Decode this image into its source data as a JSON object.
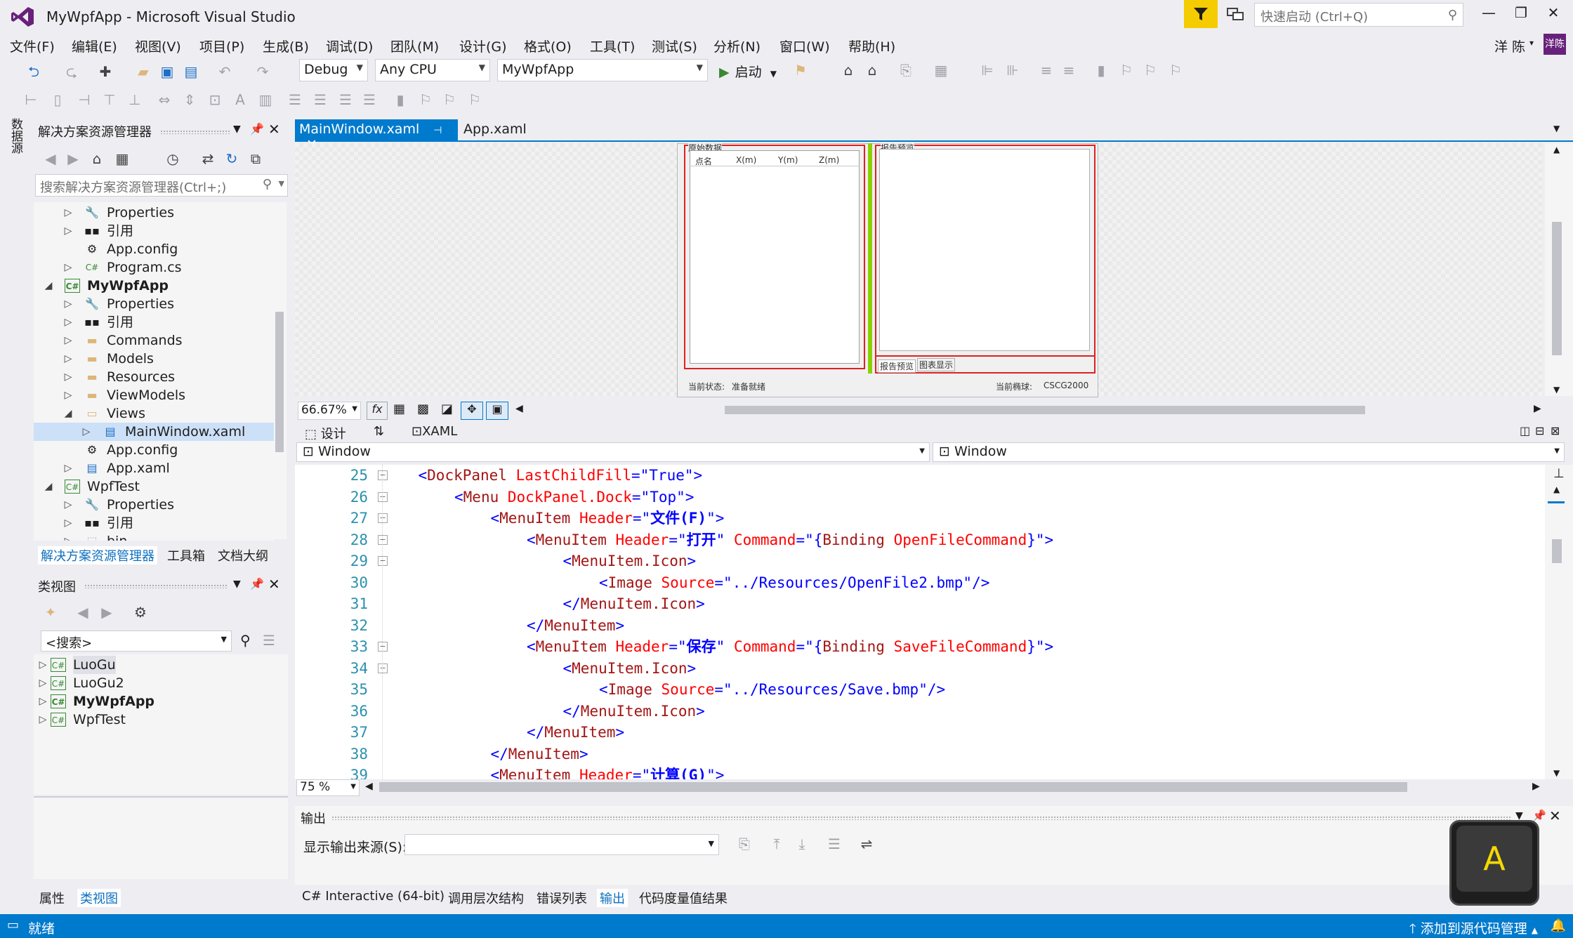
{
  "window": {
    "title": "MyWpfApp - Microsoft Visual Studio",
    "quick_launch_placeholder": "快速启动 (Ctrl+Q)",
    "user": "洋 陈",
    "avatar": "洋陈"
  },
  "menu": [
    "文件(F)",
    "编辑(E)",
    "视图(V)",
    "项目(P)",
    "生成(B)",
    "调试(D)",
    "团队(M)",
    "设计(G)",
    "格式(O)",
    "工具(T)",
    "测试(S)",
    "分析(N)",
    "窗口(W)",
    "帮助(H)"
  ],
  "toolbar": {
    "config": "Debug",
    "platform": "Any CPU",
    "startup_project": "MyWpfApp",
    "start_label": "启动"
  },
  "side_strip": {
    "datasource_label": "数据源"
  },
  "solution_explorer": {
    "title": "解决方案资源管理器",
    "search_placeholder": "搜索解决方案资源管理器(Ctrl+;)",
    "items": [
      {
        "label": "Properties",
        "icon": "wrench-icon",
        "bold": false
      },
      {
        "label": "引用",
        "icon": "reference-icon",
        "bold": false
      },
      {
        "label": "App.config",
        "icon": "config-icon",
        "bold": false
      },
      {
        "label": "Program.cs",
        "icon": "csharp-file-icon",
        "bold": false
      },
      {
        "label": "MyWpfApp",
        "icon": "csharp-project-icon",
        "bold": true
      },
      {
        "label": "Properties",
        "icon": "wrench-icon",
        "bold": false
      },
      {
        "label": "引用",
        "icon": "reference-icon",
        "bold": false
      },
      {
        "label": "Commands",
        "icon": "folder-icon",
        "bold": false
      },
      {
        "label": "Models",
        "icon": "folder-icon",
        "bold": false
      },
      {
        "label": "Resources",
        "icon": "folder-icon",
        "bold": false
      },
      {
        "label": "ViewModels",
        "icon": "folder-icon",
        "bold": false
      },
      {
        "label": "Views",
        "icon": "folder-open-icon",
        "bold": false
      },
      {
        "label": "MainWindow.xaml",
        "icon": "xaml-file-icon",
        "bold": false
      },
      {
        "label": "App.config",
        "icon": "config-icon",
        "bold": false
      },
      {
        "label": "App.xaml",
        "icon": "xaml-file-icon",
        "bold": false
      },
      {
        "label": "WpfTest",
        "icon": "csharp-project-icon",
        "bold": false
      },
      {
        "label": "Properties",
        "icon": "wrench-icon",
        "bold": false
      },
      {
        "label": "引用",
        "icon": "reference-icon",
        "bold": false
      },
      {
        "label": "bin",
        "icon": "folder-dashed-icon",
        "bold": false
      }
    ],
    "tabs": [
      "解决方案资源管理器",
      "工具箱",
      "文档大纲"
    ]
  },
  "class_view": {
    "title": "类视图",
    "search_value": "<搜索>",
    "items": [
      {
        "label": "LuoGu",
        "bold": false
      },
      {
        "label": "LuoGu2",
        "bold": false
      },
      {
        "label": "MyWpfApp",
        "bold": true
      },
      {
        "label": "WpfTest",
        "bold": false
      }
    ],
    "bottom_tabs": [
      "属性",
      "类视图"
    ]
  },
  "document_tabs": [
    {
      "label": "MainWindow.xaml",
      "active": true
    },
    {
      "label": "App.xaml",
      "active": false
    }
  ],
  "designer_preview": {
    "raw_group_header": "原始数据",
    "columns": [
      "点名",
      "X(m)",
      "Y(m)",
      "Z(m)"
    ],
    "report_group_header": "报告预览",
    "report_tabs": [
      "报告预览",
      "图表显示"
    ],
    "status_label": "当前状态:",
    "status_value": "准备就绪",
    "ellipsoid_label": "当前椭球:",
    "ellipsoid_value": "CSCG2000"
  },
  "designer": {
    "zoom": "66.67%",
    "split_tabs": [
      "设计",
      "XAML"
    ],
    "element_left": "Window",
    "element_right": "Window"
  },
  "code": {
    "zoom": "75 %",
    "lines": [
      {
        "n": "25",
        "indent": 1,
        "parts": [
          [
            "br",
            "<"
          ],
          [
            "el",
            "DockPanel"
          ],
          [
            "sp",
            " "
          ],
          [
            "at",
            "LastChildFill"
          ],
          [
            "br",
            "=\""
          ],
          [
            "v",
            "True"
          ],
          [
            "br",
            "\">"
          ]
        ]
      },
      {
        "n": "26",
        "indent": 2,
        "parts": [
          [
            "br",
            "<"
          ],
          [
            "el",
            "Menu"
          ],
          [
            "sp",
            " "
          ],
          [
            "at",
            "DockPanel.Dock"
          ],
          [
            "br",
            "=\""
          ],
          [
            "v",
            "Top"
          ],
          [
            "br",
            "\">"
          ]
        ]
      },
      {
        "n": "27",
        "indent": 3,
        "parts": [
          [
            "br",
            "<"
          ],
          [
            "el",
            "MenuItem"
          ],
          [
            "sp",
            " "
          ],
          [
            "at",
            "Header"
          ],
          [
            "br",
            "=\""
          ],
          [
            "cn",
            "文件(F)"
          ],
          [
            "br",
            "\">"
          ]
        ]
      },
      {
        "n": "28",
        "indent": 4,
        "parts": [
          [
            "br",
            "<"
          ],
          [
            "el",
            "MenuItem"
          ],
          [
            "sp",
            " "
          ],
          [
            "at",
            "Header"
          ],
          [
            "br",
            "=\""
          ],
          [
            "cn",
            "打开"
          ],
          [
            "br",
            "\""
          ],
          [
            "sp",
            " "
          ],
          [
            "at",
            "Command"
          ],
          [
            "br",
            "=\"{"
          ],
          [
            "el",
            "Binding"
          ],
          [
            "sp",
            " "
          ],
          [
            "at",
            "OpenFileCommand"
          ],
          [
            "br",
            "}\">"
          ]
        ]
      },
      {
        "n": "29",
        "indent": 5,
        "parts": [
          [
            "br",
            "<"
          ],
          [
            "el",
            "MenuItem.Icon"
          ],
          [
            "br",
            ">"
          ]
        ]
      },
      {
        "n": "30",
        "indent": 6,
        "parts": [
          [
            "br",
            "<"
          ],
          [
            "el",
            "Image"
          ],
          [
            "sp",
            " "
          ],
          [
            "at",
            "Source"
          ],
          [
            "br",
            "=\""
          ],
          [
            "v",
            "../Resources/OpenFile2.bmp"
          ],
          [
            "br",
            "\"/>"
          ]
        ]
      },
      {
        "n": "31",
        "indent": 5,
        "parts": [
          [
            "br",
            "</"
          ],
          [
            "el",
            "MenuItem.Icon"
          ],
          [
            "br",
            ">"
          ]
        ]
      },
      {
        "n": "32",
        "indent": 4,
        "parts": [
          [
            "br",
            "</"
          ],
          [
            "el",
            "MenuItem"
          ],
          [
            "br",
            ">"
          ]
        ]
      },
      {
        "n": "33",
        "indent": 4,
        "parts": [
          [
            "br",
            "<"
          ],
          [
            "el",
            "MenuItem"
          ],
          [
            "sp",
            " "
          ],
          [
            "at",
            "Header"
          ],
          [
            "br",
            "=\""
          ],
          [
            "cn",
            "保存"
          ],
          [
            "br",
            "\""
          ],
          [
            "sp",
            " "
          ],
          [
            "at",
            "Command"
          ],
          [
            "br",
            "=\"{"
          ],
          [
            "el",
            "Binding"
          ],
          [
            "sp",
            " "
          ],
          [
            "at",
            "SaveFileCommand"
          ],
          [
            "br",
            "}\">"
          ]
        ]
      },
      {
        "n": "34",
        "indent": 5,
        "parts": [
          [
            "br",
            "<"
          ],
          [
            "el",
            "MenuItem.Icon"
          ],
          [
            "br",
            ">"
          ]
        ]
      },
      {
        "n": "35",
        "indent": 6,
        "parts": [
          [
            "br",
            "<"
          ],
          [
            "el",
            "Image"
          ],
          [
            "sp",
            " "
          ],
          [
            "at",
            "Source"
          ],
          [
            "br",
            "=\""
          ],
          [
            "v",
            "../Resources/Save.bmp"
          ],
          [
            "br",
            "\"/>"
          ]
        ]
      },
      {
        "n": "36",
        "indent": 5,
        "parts": [
          [
            "br",
            "</"
          ],
          [
            "el",
            "MenuItem.Icon"
          ],
          [
            "br",
            ">"
          ]
        ]
      },
      {
        "n": "37",
        "indent": 4,
        "parts": [
          [
            "br",
            "</"
          ],
          [
            "el",
            "MenuItem"
          ],
          [
            "br",
            ">"
          ]
        ]
      },
      {
        "n": "38",
        "indent": 3,
        "parts": [
          [
            "br",
            "</"
          ],
          [
            "el",
            "MenuItem"
          ],
          [
            "br",
            ">"
          ]
        ]
      },
      {
        "n": "39",
        "indent": 3,
        "parts": [
          [
            "br",
            "<"
          ],
          [
            "el",
            "MenuItem"
          ],
          [
            "sp",
            " "
          ],
          [
            "at",
            "Header"
          ],
          [
            "br",
            "=\""
          ],
          [
            "cn",
            "计算(G)"
          ],
          [
            "br",
            "\">"
          ]
        ]
      }
    ]
  },
  "output": {
    "title": "输出",
    "source_label": "显示输出来源(S):",
    "tabs": [
      "C# Interactive (64-bit)",
      "调用层次结构",
      "错误列表",
      "输出",
      "代码度量值结果"
    ]
  },
  "status": {
    "left": "就绪",
    "right": "添加到源代码管理"
  },
  "key_overlay": "A",
  "colors": {
    "accent": "#007acc",
    "filter": "#f5cc00",
    "avatar": "#68217a"
  }
}
